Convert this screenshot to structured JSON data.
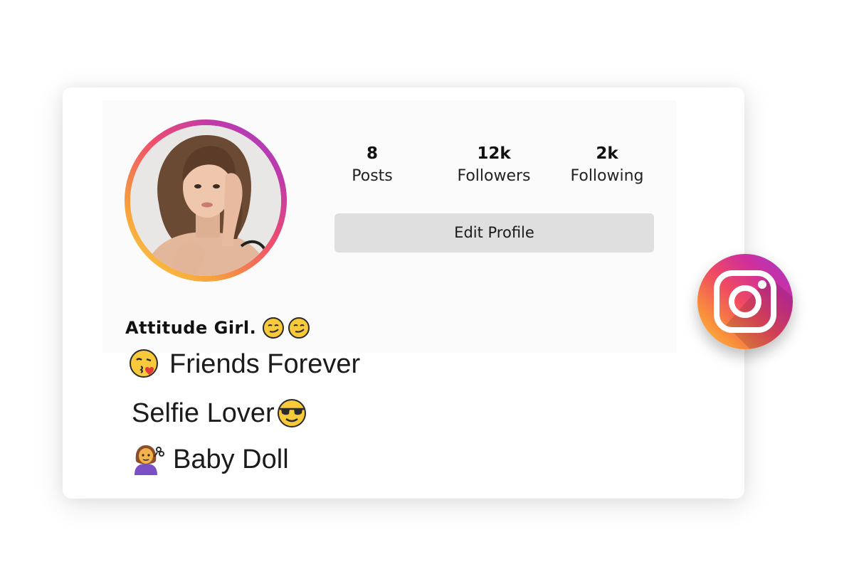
{
  "profile": {
    "name": "Attitude Girl.",
    "stats": [
      {
        "value": "8",
        "label": "Posts"
      },
      {
        "value": "12k",
        "label": "Followers"
      },
      {
        "value": "2k",
        "label": "Following"
      }
    ],
    "edit_button_label": "Edit Profile",
    "bio": [
      {
        "emoji": "kissing-face-icon",
        "text": "Friends Forever"
      },
      {
        "emoji": "sunglasses-face-icon",
        "text": "Selfie Lover"
      },
      {
        "emoji": "woman-getting-haircut-icon",
        "text": "Baby Doll"
      }
    ]
  },
  "badge": {
    "icon": "instagram-logo-icon"
  },
  "colors": {
    "ring_gradient": [
      "#fcd34a",
      "#f6a33b",
      "#ee4d6e",
      "#c23aa8",
      "#9a3fd1"
    ],
    "button_bg": "#dfdfdf"
  }
}
